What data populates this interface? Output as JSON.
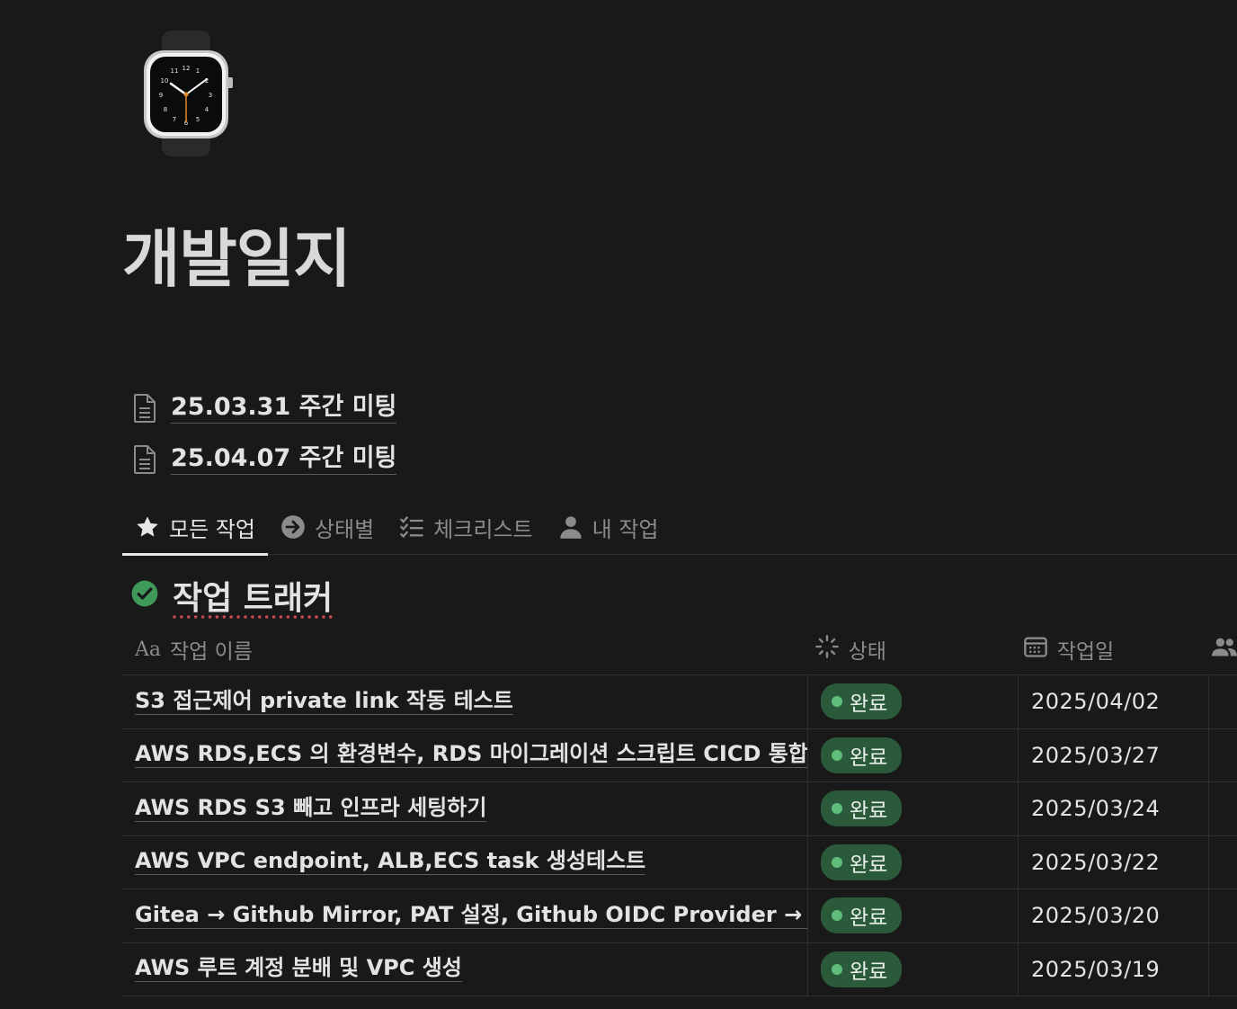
{
  "page": {
    "title": "개발일지",
    "icon": "apple-watch-icon"
  },
  "linked_pages": [
    {
      "label": "25.03.31 주간 미팅",
      "icon": "document-icon"
    },
    {
      "label": "25.04.07 주간 미팅",
      "icon": "document-icon"
    }
  ],
  "tabs": [
    {
      "label": "모든 작업",
      "icon": "star-icon",
      "active": true
    },
    {
      "label": "상태별",
      "icon": "arrow-circle-icon",
      "active": false
    },
    {
      "label": "체크리스트",
      "icon": "checklist-icon",
      "active": false
    },
    {
      "label": "내 작업",
      "icon": "person-icon",
      "active": false
    }
  ],
  "database": {
    "title": "작업 트래커",
    "icon": "check-circle-icon",
    "columns": {
      "name": {
        "prefix": "Aa",
        "label": "작업 이름"
      },
      "status": {
        "label": "상태",
        "icon": "status-icon"
      },
      "date": {
        "label": "작업일",
        "icon": "calendar-icon"
      },
      "extra": {
        "icon": "people-icon"
      }
    },
    "rows": [
      {
        "name": "S3 접근제어 private link 작동 테스트",
        "status": "완료",
        "date": "2025/04/02"
      },
      {
        "name": "AWS RDS,ECS 의 환경변수, RDS 마이그레이션 스크립트 CICD 통합",
        "status": "완료",
        "date": "2025/03/27"
      },
      {
        "name": "AWS RDS S3 빼고 인프라 세팅하기",
        "status": "완료",
        "date": "2025/03/24"
      },
      {
        "name": "AWS VPC endpoint, ALB,ECS task 생성테스트",
        "status": "완료",
        "date": "2025/03/22"
      },
      {
        "name": "Gitea → Github Mirror, PAT 설정, Github OIDC Provider → AWS IA",
        "status": "완료",
        "date": "2025/03/20"
      },
      {
        "name": "AWS 루트 계정 분배 및 VPC 생성",
        "status": "완료",
        "date": "2025/03/19"
      }
    ]
  },
  "colors": {
    "background": "#191919",
    "status_done_bg": "#2b5a3a",
    "status_done_dot": "#5fbf7a",
    "check_green": "#3f9a5a"
  }
}
